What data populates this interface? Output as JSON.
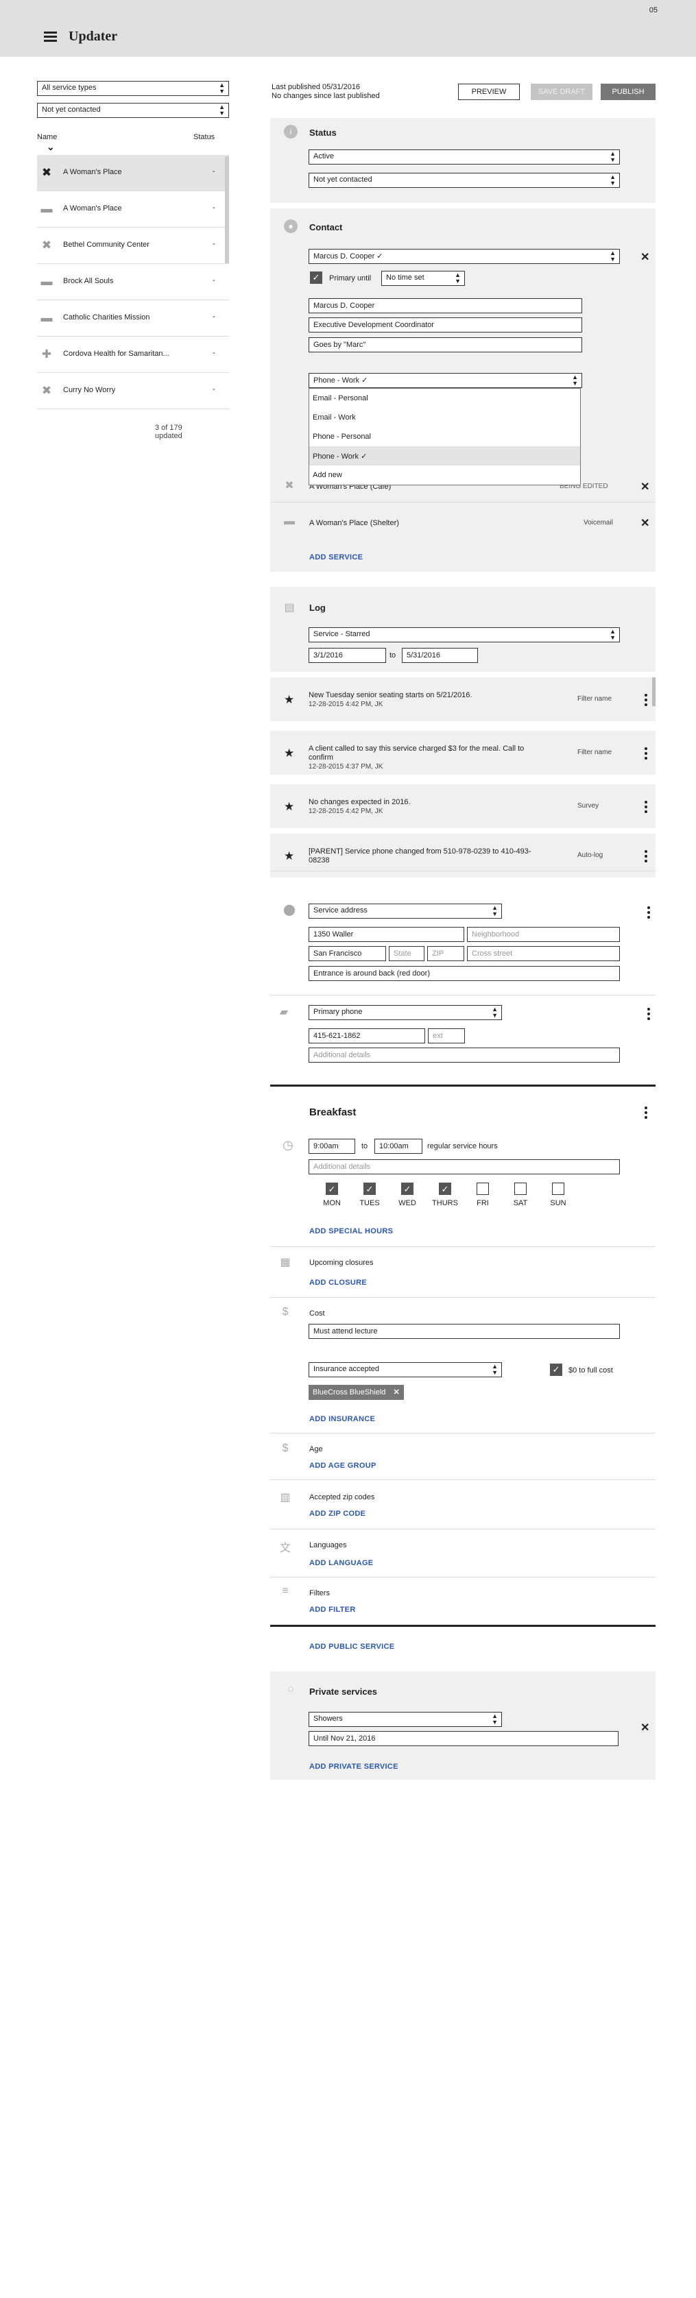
{
  "app": {
    "title": "Updater",
    "badge": "05"
  },
  "sidebar": {
    "filter_type": "All service types",
    "filter_contact": "Not yet contacted",
    "col_name": "Name",
    "col_status": "Status",
    "items": [
      {
        "name": "A Woman's Place",
        "status": "-",
        "icon": "restaurant-icon",
        "glyph": "✖"
      },
      {
        "name": "A Woman's Place",
        "status": "-",
        "icon": "bed-icon",
        "glyph": "▬"
      },
      {
        "name": "Bethel Community Center",
        "status": "-",
        "icon": "restaurant-icon",
        "glyph": "✖"
      },
      {
        "name": "Brock All Souls",
        "status": "-",
        "icon": "bed-icon",
        "glyph": "▬"
      },
      {
        "name": "Catholic Charities Mission",
        "status": "-",
        "icon": "bed-icon",
        "glyph": "▬"
      },
      {
        "name": "Cordova Health for Samaritan...",
        "status": "-",
        "icon": "medical-icon",
        "glyph": "✚"
      },
      {
        "name": "Curry No Worry",
        "status": "-",
        "icon": "restaurant-icon",
        "glyph": "✖"
      }
    ],
    "count": "3 of 179 updated"
  },
  "publish": {
    "last_published": "Last published 05/31/2016",
    "changes": "No changes since last published",
    "preview": "PREVIEW",
    "save_draft": "SAVE DRAFT",
    "publish": "PUBLISH"
  },
  "status": {
    "title": "Status",
    "value1": "Active",
    "value2": "Not yet contacted"
  },
  "contact": {
    "title": "Contact",
    "person": "Marcus D. Cooper ✓",
    "primary_until": "Primary until",
    "time": "No time set",
    "name": "Marcus D. Cooper",
    "role": "Executive Development Coordinator",
    "nickname": "Goes by \"Marc\"",
    "method": "Phone - Work ✓",
    "options": [
      "Email - Personal",
      "Email - Work",
      "Phone - Personal",
      "Phone - Work ✓",
      "Add new"
    ],
    "service1_name": "A Woman's Place (Café)",
    "service1_status": "BEING EDITED",
    "service2_name": "A Woman's Place (Shelter)",
    "service2_status": "Voicemail",
    "add_service": "ADD SERVICE"
  },
  "log": {
    "title": "Log",
    "filter": "Service - Starred",
    "from": "3/1/2016",
    "to_label": "to",
    "to": "5/31/2016",
    "items": [
      {
        "text": "New Tuesday senior seating starts on 5/21/2016.",
        "meta": "12-28-2015 4:42 PM, JK",
        "source": "Filter name"
      },
      {
        "text": "A client called to say this service charged $3 for the meal. Call to confirm",
        "meta": "12-28-2015 4:37 PM, JK",
        "source": "Filter name"
      },
      {
        "text": "No changes expected in 2016.",
        "meta": "12-28-2015 4:42 PM, JK",
        "source": "Survey"
      },
      {
        "text": "[PARENT] Service phone changed from 510-978-0239 to 410-493-08238",
        "meta": "",
        "source": "Auto-log"
      }
    ]
  },
  "address": {
    "type": "Service address",
    "street": "1350 Waller",
    "neighborhood_ph": "Neighborhood",
    "city": "San Francisco",
    "state_ph": "State",
    "zip_ph": "ZIP",
    "cross_ph": "Cross street",
    "note": "Entrance is around back (red door)"
  },
  "phone": {
    "type": "Primary phone",
    "number": "415-621-1862",
    "ext_ph": "ext",
    "details_ph": "Additional details"
  },
  "breakfast": {
    "title": "Breakfast",
    "start": "9:00am",
    "to": "to",
    "end": "10:00am",
    "hours_label": "regular service hours",
    "details_ph": "Additional details",
    "days": [
      {
        "label": "MON",
        "on": true
      },
      {
        "label": "TUES",
        "on": true
      },
      {
        "label": "WED",
        "on": true
      },
      {
        "label": "THURS",
        "on": true
      },
      {
        "label": "FRI",
        "on": false
      },
      {
        "label": "SAT",
        "on": false
      },
      {
        "label": "SUN",
        "on": false
      }
    ],
    "add_special": "ADD SPECIAL HOURS",
    "closures_label": "Upcoming closures",
    "add_closure": "ADD CLOSURE",
    "cost_label": "Cost",
    "cost_value": "Must attend lecture",
    "insurance": "Insurance accepted",
    "full_cost": "$0 to full cost",
    "chip": "BlueCross BlueShield",
    "add_insurance": "ADD INSURANCE",
    "age_label": "Age",
    "add_age": "ADD AGE GROUP",
    "zip_label": "Accepted zip codes",
    "add_zip": "ADD ZIP CODE",
    "lang_label": "Languages",
    "add_lang": "ADD LANGUAGE",
    "filters_label": "Filters",
    "add_filter": "ADD FILTER",
    "add_public": "ADD PUBLIC SERVICE"
  },
  "private": {
    "title": "Private services",
    "value": "Showers",
    "until": "Until Nov 21, 2016",
    "add": "ADD PRIVATE SERVICE"
  }
}
